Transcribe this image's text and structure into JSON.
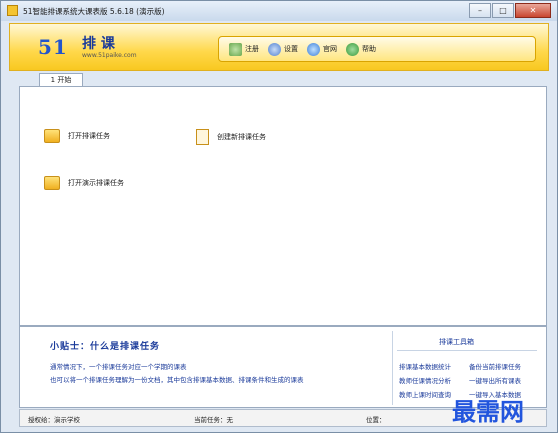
{
  "window": {
    "title": "51智能排课系统大课表版 5.6.18 (演示版)",
    "controls": [
      "–",
      "□",
      "✕"
    ]
  },
  "header": {
    "logo": {
      "number": "51",
      "title": "排 课",
      "url": "www.51paike.com"
    },
    "toolbar": [
      {
        "label": "注册",
        "icon": "register-pen-icon",
        "color": "#6aa84f"
      },
      {
        "label": "设置",
        "icon": "gear-icon",
        "color": "#4f7fd0"
      },
      {
        "label": "官网",
        "icon": "globe-icon",
        "color": "#3b7dd8"
      },
      {
        "label": "帮助",
        "icon": "help-icon",
        "color": "#3a9a3a"
      }
    ]
  },
  "tabs": [
    {
      "label": "1 开始",
      "active": true
    }
  ],
  "actions": {
    "open_task": "打开排课任务",
    "new_task": "创建新排课任务",
    "open_demo": "打开演示排课任务"
  },
  "tips": {
    "title": "小贴士：什么是排课任务",
    "line1": "通常情况下，一个排课任务对应一个学期的课表",
    "line2": "也可以将一个排课任务理解为一份文档，其中包含排课基本数据、排课条件和生成的课表"
  },
  "toolbox": {
    "title": "排课工具箱",
    "links": [
      "排课基本数据统计",
      "备份当前排课任务",
      "教师任课情况分析",
      "一键导出所有课表",
      "教师上课时间查询",
      "一键导入基本数据"
    ]
  },
  "status": {
    "license": "授权给：演示学校",
    "current_task": "当前任务：无",
    "position": "位置："
  },
  "watermark": "最需网"
}
